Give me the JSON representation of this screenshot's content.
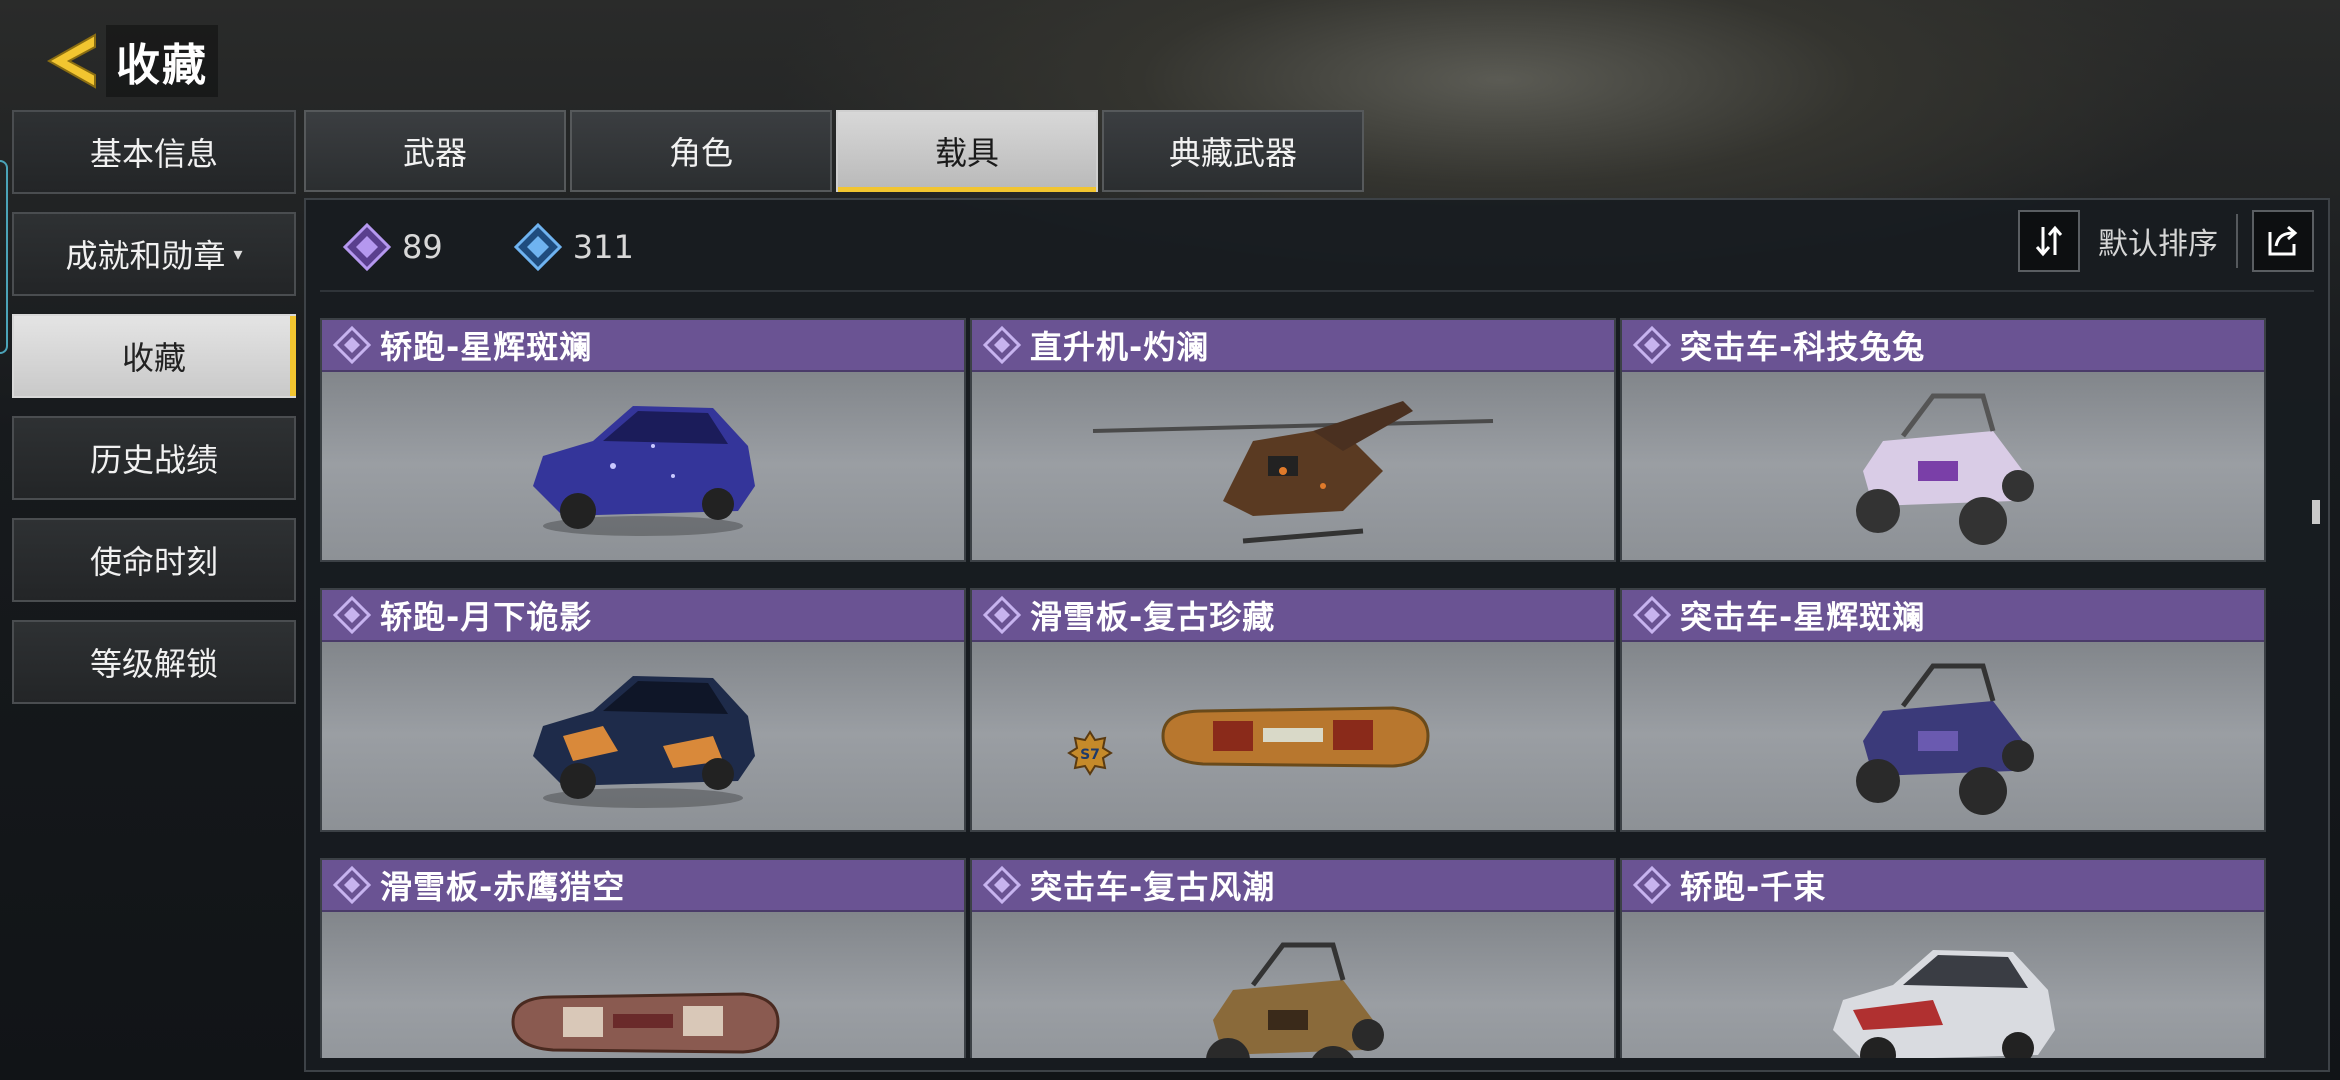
{
  "header": {
    "title": "收藏"
  },
  "sidebar": {
    "items": [
      {
        "label": "基本信息"
      },
      {
        "label": "成就和勋章"
      },
      {
        "label": "收藏"
      },
      {
        "label": "历史战绩"
      },
      {
        "label": "使命时刻"
      },
      {
        "label": "等级解锁"
      }
    ]
  },
  "tabs": [
    {
      "label": "武器"
    },
    {
      "label": "角色"
    },
    {
      "label": "载具"
    },
    {
      "label": "典藏武器"
    }
  ],
  "counters": [
    {
      "icon": "purple-diamond-icon",
      "color": "#9b7ad6",
      "value": "89"
    },
    {
      "icon": "blue-diamond-icon",
      "color": "#5aa2e6",
      "value": "311"
    }
  ],
  "sort": {
    "label": "默认排序"
  },
  "items": [
    {
      "name": "轿跑-星辉斑斓",
      "type": "car",
      "color": "#3b3a9a"
    },
    {
      "name": "直升机-灼澜",
      "type": "helicopter",
      "color": "#7a4b2a"
    },
    {
      "name": "突击车-科技兔兔",
      "type": "buggy",
      "color": "#c9b3dd"
    },
    {
      "name": "轿跑-月下诡影",
      "type": "car",
      "color": "#1e2b4a"
    },
    {
      "name": "滑雪板-复古珍藏",
      "type": "board",
      "color": "#b8772e",
      "badge": "S7"
    },
    {
      "name": "突击车-星辉斑斓",
      "type": "buggy",
      "color": "#3b3a7a"
    },
    {
      "name": "滑雪板-赤鹰猎空",
      "type": "board",
      "color": "#8a5a50"
    },
    {
      "name": "突击车-复古风潮",
      "type": "buggy",
      "color": "#8a6a3a"
    },
    {
      "name": "轿跑-千束",
      "type": "car",
      "color": "#d9dbe0"
    }
  ]
}
